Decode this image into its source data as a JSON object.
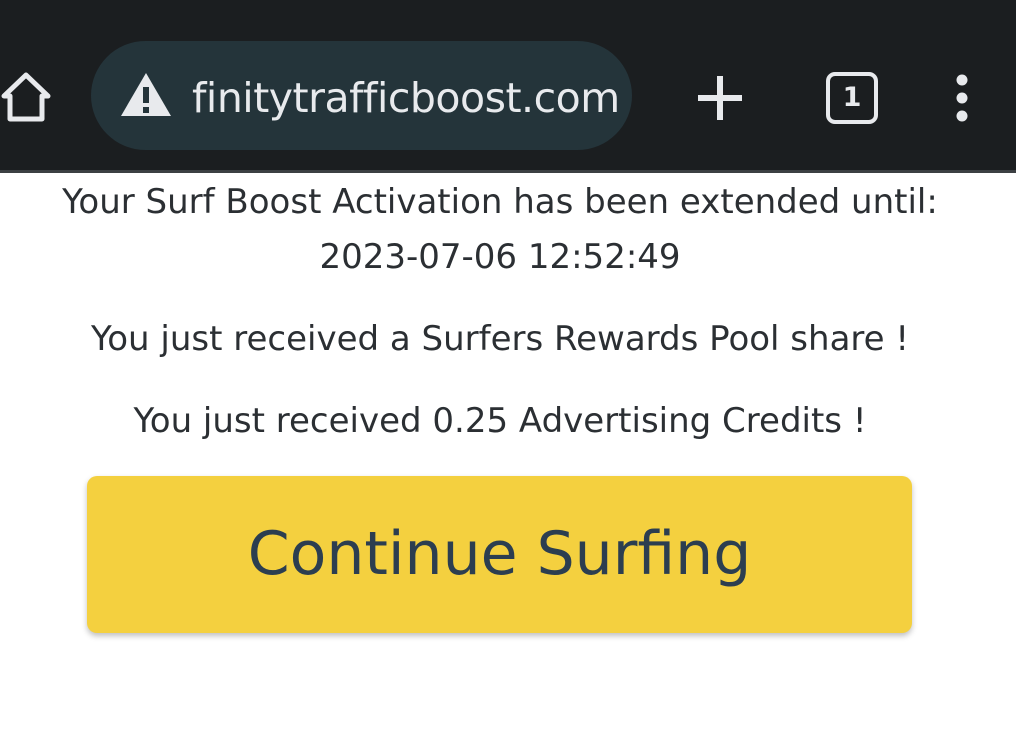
{
  "browser": {
    "url": "finitytrafficboost.com",
    "tab_count": "1",
    "icons": {
      "home": "home-icon",
      "warning": "warning-icon",
      "new_tab": "plus-icon",
      "tabs": "tab-switcher-icon",
      "menu": "more-vert-icon"
    }
  },
  "message": {
    "extension_line": "Your Surf Boost Activation has been extended until:",
    "extension_date": "2023-07-06 12:52:49",
    "rewards_line": "You just received a Surfers Rewards Pool share !",
    "credits_line": "You just received 0.25 Advertising Credits !"
  },
  "actions": {
    "continue_label": "Continue Surfing"
  },
  "colors": {
    "toolbar_bg": "#1b1e20",
    "url_pill_bg": "#24343a",
    "button_bg": "#f4d03f",
    "button_text": "#2c3e50",
    "body_text": "#2b2f33"
  }
}
